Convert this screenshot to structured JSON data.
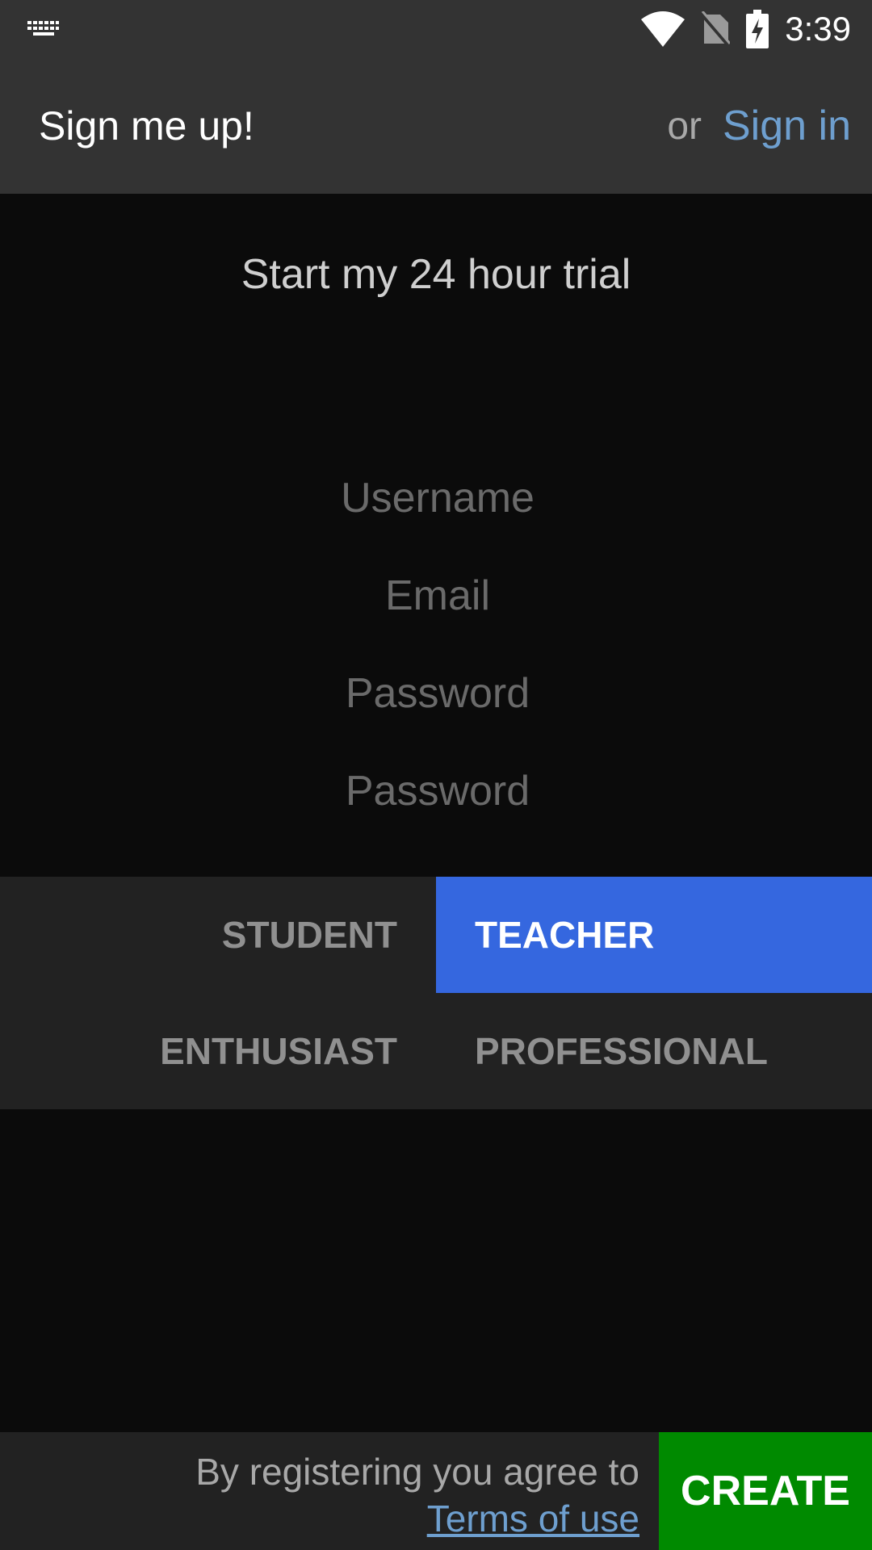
{
  "status_bar": {
    "time": "3:39",
    "icons": [
      "keyboard-icon",
      "wifi-icon",
      "no-sim-icon",
      "battery-charging-icon"
    ]
  },
  "app_bar": {
    "title": "Sign me up!",
    "or_text": "or",
    "sign_in_label": "Sign in"
  },
  "form": {
    "heading": "Start my 24 hour trial",
    "username": {
      "placeholder": "Username",
      "value": ""
    },
    "email": {
      "placeholder": "Email",
      "value": ""
    },
    "password": {
      "placeholder": "Password",
      "value": ""
    },
    "password_confirm": {
      "placeholder": "Password",
      "value": ""
    }
  },
  "roles": {
    "options": [
      {
        "label": "STUDENT",
        "selected": false
      },
      {
        "label": "TEACHER",
        "selected": true
      },
      {
        "label": "ENTHUSIAST",
        "selected": false
      },
      {
        "label": "PROFESSIONAL",
        "selected": false
      }
    ]
  },
  "footer": {
    "agree_text": "By registering you agree to",
    "terms_label": "Terms of use",
    "create_label": "CREATE"
  },
  "colors": {
    "bar_background": "#333333",
    "page_background": "#0b0b0b",
    "panel_background": "#222222",
    "link": "#6e9fcf",
    "selected_role": "#3567df",
    "create_button": "#008a00"
  }
}
